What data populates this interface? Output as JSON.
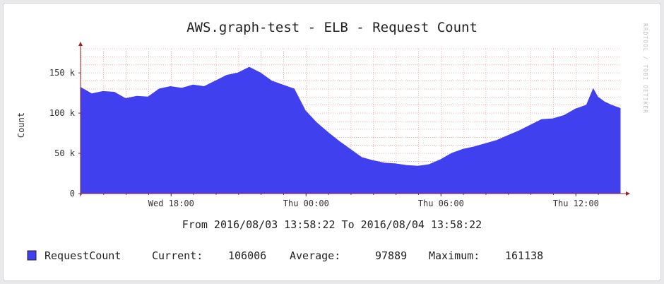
{
  "chart_data": {
    "type": "area",
    "title": "AWS.graph-test - ELB - Request Count",
    "ylabel": "Count",
    "xlabel": "",
    "watermark": "RRDTOOL / TOBI OETIKER",
    "time_range_label": "From 2016/08/03 13:58:22 To 2016/08/04 13:58:22",
    "x_start": "2016/08/03 13:58:22",
    "x_end": "2016/08/04 13:58:22",
    "ylim": [
      0,
      180000
    ],
    "y_ticks": [
      {
        "value": 0,
        "label": "0"
      },
      {
        "value": 50000,
        "label": "50 k"
      },
      {
        "value": 100000,
        "label": "100 k"
      },
      {
        "value": 150000,
        "label": "150 k"
      }
    ],
    "x_ticks": [
      {
        "hour": 4.03,
        "label": "Wed 18:00"
      },
      {
        "hour": 10.03,
        "label": "Thu 00:00"
      },
      {
        "hour": 16.03,
        "label": "Thu 06:00"
      },
      {
        "hour": 22.03,
        "label": "Thu 12:00"
      }
    ],
    "grid": true,
    "area_color": "#4040ee",
    "grid_color": "#f08080",
    "axis_color": "#a02020",
    "series": [
      {
        "name": "RequestCount",
        "x_hours": [
          0,
          0.5,
          1,
          1.5,
          2,
          2.5,
          3,
          3.5,
          4,
          4.5,
          5,
          5.5,
          6,
          6.5,
          7,
          7.5,
          8,
          8.5,
          9,
          9.5,
          10,
          10.5,
          11,
          11.5,
          12,
          12.5,
          13,
          13.5,
          14,
          14.5,
          15,
          15.5,
          16,
          16.5,
          17,
          17.5,
          18,
          18.5,
          19,
          19.5,
          20,
          20.5,
          21,
          21.5,
          22,
          22.5,
          22.8,
          23,
          23.3,
          23.6,
          24
        ],
        "values": [
          132000,
          124000,
          127000,
          126000,
          118000,
          121000,
          120000,
          130000,
          133000,
          131000,
          135000,
          133000,
          140000,
          147000,
          150000,
          157000,
          150000,
          140000,
          135000,
          130000,
          103000,
          88000,
          76000,
          65000,
          55000,
          45000,
          41000,
          38000,
          37000,
          35000,
          34000,
          36000,
          42000,
          50000,
          55000,
          58000,
          62000,
          66000,
          72000,
          78000,
          85000,
          92000,
          93000,
          97000,
          105000,
          110000,
          130000,
          120000,
          114000,
          110000,
          106000
        ]
      }
    ]
  },
  "legend": {
    "series_name": "RequestCount",
    "current_label": "Current:",
    "current_value": "106006",
    "average_label": "Average:",
    "average_value": "97889",
    "maximum_label": "Maximum:",
    "maximum_value": "161138"
  }
}
